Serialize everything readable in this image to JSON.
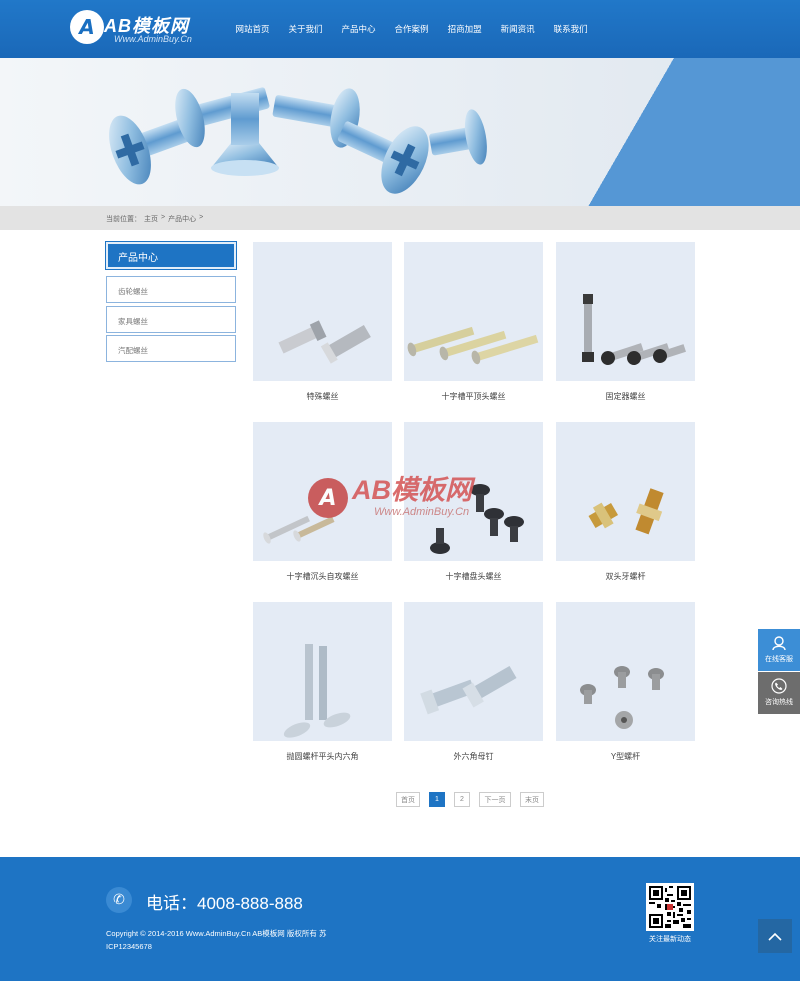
{
  "brand": {
    "logo_letter": "A",
    "name": "AB模板网",
    "sub": "Www.AdminBuy.Cn"
  },
  "nav": [
    {
      "label": "网站首页"
    },
    {
      "label": "关于我们"
    },
    {
      "label": "产品中心"
    },
    {
      "label": "合作案例"
    },
    {
      "label": "招商加盟"
    },
    {
      "label": "新闻资讯"
    },
    {
      "label": "联系我们"
    }
  ],
  "breadcrumb": {
    "prefix": "当前位置：",
    "home": "主页",
    "sep1": ">",
    "current": "产品中心",
    "sep2": ">"
  },
  "sidebar": {
    "title": "产品中心",
    "items": [
      {
        "label": "齿轮螺丝"
      },
      {
        "label": "家具螺丝"
      },
      {
        "label": "汽配螺丝"
      }
    ]
  },
  "products": [
    {
      "name": "特殊螺丝",
      "icon": "screw-pair-icon"
    },
    {
      "name": "十字槽平顶头螺丝",
      "icon": "long-screws-icon"
    },
    {
      "name": "固定器螺丝",
      "icon": "black-bolts-icon"
    },
    {
      "name": "十字槽沉头自攻螺丝",
      "icon": "tapping-screws-icon"
    },
    {
      "name": "十字槽盘头螺丝",
      "icon": "pan-head-screws-icon"
    },
    {
      "name": "双头牙螺杆",
      "icon": "stud-bolts-icon"
    },
    {
      "name": "抛圆螺杆平头内六角",
      "icon": "hex-socket-bolts-icon"
    },
    {
      "name": "外六角母钉",
      "icon": "hex-head-bolts-icon"
    },
    {
      "name": "Y型螺杆",
      "icon": "y-bolts-icon"
    }
  ],
  "watermark": {
    "letter": "A",
    "name": "AB模板网",
    "sub": "Www.AdminBuy.Cn"
  },
  "pagination": {
    "first": "首页",
    "pages": [
      "1",
      "2"
    ],
    "next": "下一页",
    "last": "末页"
  },
  "float": {
    "online": "在线客服",
    "hotline": "咨询热线"
  },
  "footer": {
    "phone": "电话：4008-888-888",
    "copyright": "Copyright © 2014-2016 Www.AdminBuy.Cn AB模板网 版权所有    苏ICP12345678",
    "qr_caption": "关注最新动态"
  },
  "colors": {
    "primary": "#1e74c4",
    "banner_accent": "#5b9ed8",
    "footer": "#1e74c4"
  }
}
